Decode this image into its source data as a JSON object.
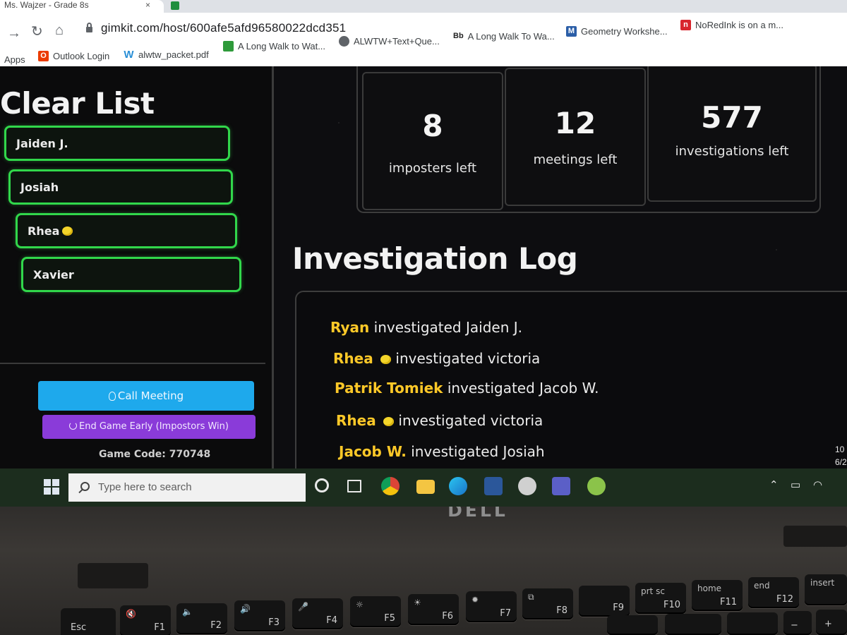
{
  "browser": {
    "active_tab_title": "Ms. Wajzer - Grade 8s",
    "tab_close": "×",
    "url": "gimkit.com/host/600afe5afd96580022dcd351",
    "bookmarks": [
      {
        "label": "Apps",
        "icon": "apps-icon"
      },
      {
        "label": "Outlook Login",
        "icon": "office-icon",
        "color": "#eb3c00"
      },
      {
        "label": "alwtw_packet.pdf",
        "icon": "weebly-icon",
        "color": "#2a8fd6"
      },
      {
        "label": "A Long Walk to Wat...",
        "icon": "book-icon",
        "color": "#2e9a3a"
      },
      {
        "label": "ALWTW+Text+Que...",
        "icon": "globe-icon"
      },
      {
        "label": "A Long Walk To Wa...",
        "icon": "blackboard-icon",
        "glyph": "Bb"
      },
      {
        "label": "Geometry Workshe...",
        "icon": "m-icon",
        "glyph": "M",
        "color": "#2b5ea7"
      },
      {
        "label": "NoRedInk is on a m...",
        "icon": "noredink-icon",
        "glyph": "n",
        "color": "#d8262d"
      }
    ]
  },
  "sidebar": {
    "title": "Clear List",
    "players": [
      {
        "name": "Jaiden J.",
        "lemon": false
      },
      {
        "name": "Josiah",
        "lemon": false
      },
      {
        "name": "Rhea",
        "lemon": true
      },
      {
        "name": "Xavier",
        "lemon": false
      }
    ],
    "call_meeting_label": "Call Meeting",
    "end_game_label": "End Game Early (Impostors Win)",
    "game_code_label": "Game Code:",
    "game_code": "770748"
  },
  "stats": [
    {
      "value": "8",
      "label": "imposters left"
    },
    {
      "value": "12",
      "label": "meetings left"
    },
    {
      "value": "577",
      "label": "investigations left"
    }
  ],
  "log": {
    "title": "Investigation Log",
    "entries": [
      {
        "actor": "Ryan",
        "lemon": false,
        "action": "investigated Jaiden J."
      },
      {
        "actor": "Rhea",
        "lemon": true,
        "action": "investigated victoria"
      },
      {
        "actor": "Patrik Tomiek",
        "lemon": false,
        "action": "investigated Jacob W."
      },
      {
        "actor": "Rhea",
        "lemon": true,
        "action": "investigated victoria"
      },
      {
        "actor": "Jacob W.",
        "lemon": false,
        "action": "investigated Josiah"
      }
    ]
  },
  "taskbar": {
    "search_placeholder": "Type here to search",
    "clock_time": "10",
    "clock_date": "6/2"
  },
  "device": {
    "logo": "DELL"
  },
  "keyboard": {
    "keys": [
      {
        "top": "",
        "bottom": "Esc"
      },
      {
        "top": "🔇",
        "bottom": "F1"
      },
      {
        "top": "🔈",
        "bottom": "F2"
      },
      {
        "top": "🔊",
        "bottom": "F3"
      },
      {
        "top": "🎤",
        "bottom": "F4"
      },
      {
        "top": "☼",
        "bottom": "F5"
      },
      {
        "top": "☀",
        "bottom": "F6"
      },
      {
        "top": "✹",
        "bottom": "F7"
      },
      {
        "top": "⧉",
        "bottom": "F8"
      },
      {
        "top": "",
        "bottom": "F9"
      },
      {
        "top": "prt sc",
        "bottom": "F10"
      },
      {
        "top": "home",
        "bottom": "F11"
      },
      {
        "top": "end",
        "bottom": "F12"
      },
      {
        "top": "insert",
        "bottom": ""
      }
    ],
    "lower_keys": [
      "",
      "",
      "",
      "−",
      "+"
    ]
  }
}
